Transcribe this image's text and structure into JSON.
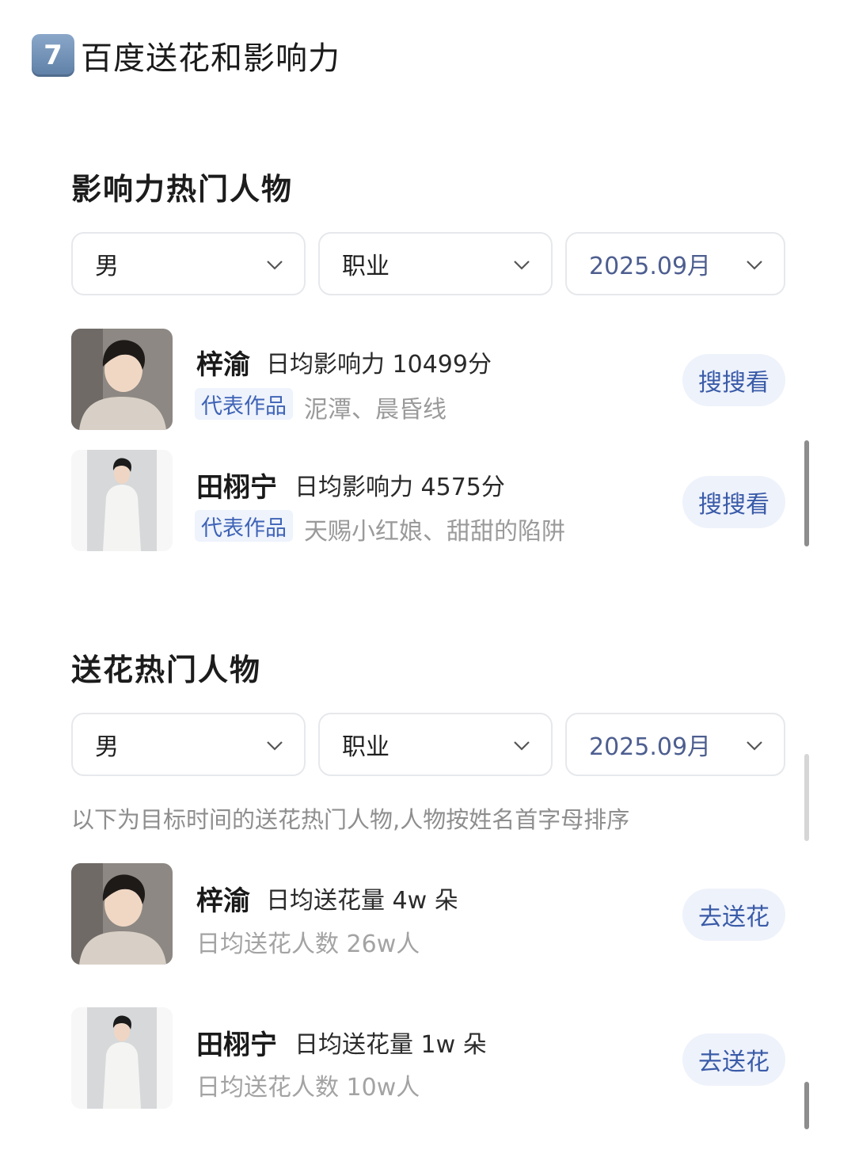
{
  "header": {
    "badge": "7",
    "title": "百度送花和影响力"
  },
  "influence": {
    "title": "影响力热门人物",
    "filters": {
      "gender": "男",
      "job": "职业",
      "month": "2025.09月"
    },
    "people": [
      {
        "name": "梓渝",
        "stat": "日均影响力 10499分",
        "tag": "代表作品",
        "works": "泥潭、晨昏线",
        "button": "搜搜看"
      },
      {
        "name": "田栩宁",
        "stat": "日均影响力 4575分",
        "tag": "代表作品",
        "works": "天赐小红娘、甜甜的陷阱",
        "button": "搜搜看"
      }
    ]
  },
  "flowers": {
    "title": "送花热门人物",
    "filters": {
      "gender": "男",
      "job": "职业",
      "month": "2025.09月"
    },
    "note": "以下为目标时间的送花热门人物,人物按姓名首字母排序",
    "people": [
      {
        "name": "梓渝",
        "stat": "日均送花量 4w 朵",
        "sub": "日均送花人数  26w人",
        "button": "去送花"
      },
      {
        "name": "田栩宁",
        "stat": "日均送花量 1w 朵",
        "sub": "日均送花人数  10w人",
        "button": "去送花"
      }
    ]
  },
  "colors": {
    "accent": "#3a5ba8",
    "button_bg": "#eef2fb",
    "tag_bg": "#eef3fc",
    "muted": "#9a9a9a"
  }
}
